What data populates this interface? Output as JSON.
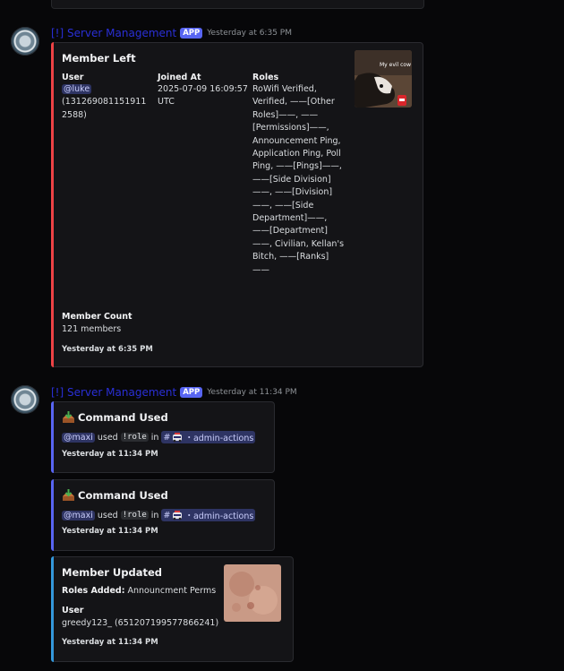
{
  "messages": [
    {
      "username": "[!] Server Management",
      "badge": "APP",
      "timestamp": "Yesterday at 6:35 PM",
      "embed": {
        "title": "Member Left",
        "fields": [
          {
            "label": "User",
            "mention": "@luke",
            "value": "(1312690811519112588)"
          },
          {
            "label": "Joined At",
            "value": "2025-07-09 16:09:57 UTC"
          },
          {
            "label": "Roles",
            "value": "RoWifi Verified, Verified, ——[Other Roles]——, ——[Permissions]——, Announcement Ping, Application Ping, Poll Ping, ——[Pings]——, ——[Side Division]——, ——[Division]——, ——[Side Department]——, ——[Department]——, Civilian, Kellan's Bitch, ——[Ranks]——"
          },
          {
            "label": "Member Count",
            "value": "121 members"
          }
        ],
        "thumbnail_caption": "My evil cow",
        "footer": "Yesterday at 6:35 PM",
        "color": "#ed4245"
      }
    },
    {
      "username": "[!] Server Management",
      "badge": "APP",
      "timestamp": "Yesterday at 11:34 PM",
      "embeds": [
        {
          "title": "Command Used",
          "mention": "@maxi",
          "used": "used",
          "command": "!role",
          "in": "in",
          "channel_hash": "#",
          "channel": "・admin-actions",
          "footer": "Yesterday at 11:34 PM",
          "color": "#5865f2"
        },
        {
          "title": "Command Used",
          "mention": "@maxi",
          "used": "used",
          "command": "!role",
          "in": "in",
          "channel_hash": "#",
          "channel": "・admin-actions",
          "footer": "Yesterday at 11:34 PM",
          "color": "#5865f2"
        },
        {
          "title": "Member Updated",
          "roles_added_label": "Roles Added:",
          "roles_added_value": "Announcment Perms",
          "user_label": "User",
          "user_value": "greedy123_ (651207199577866241)",
          "footer": "Yesterday at 11:34 PM",
          "color": "#3498db"
        }
      ]
    }
  ]
}
